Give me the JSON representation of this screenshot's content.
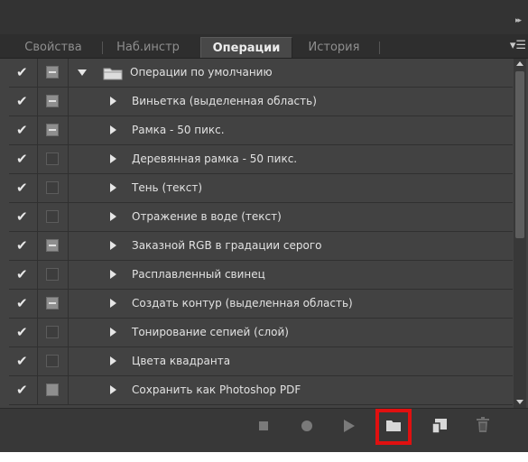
{
  "panel": {
    "tabs": [
      {
        "label": "Свойства",
        "active": false
      },
      {
        "label": "Наб.инстр",
        "active": false
      },
      {
        "label": "Операции",
        "active": true
      },
      {
        "label": "История",
        "active": false
      }
    ]
  },
  "actions": {
    "set": {
      "label": "Операции по умолчанию",
      "checked": true,
      "dialog": "on",
      "expanded": true
    },
    "items": [
      {
        "label": "Виньетка (выделенная область)",
        "checked": true,
        "dialog": "on"
      },
      {
        "label": "Рамка - 50 пикс.",
        "checked": true,
        "dialog": "on"
      },
      {
        "label": "Деревянная рамка - 50 пикс.",
        "checked": true,
        "dialog": "off"
      },
      {
        "label": "Тень (текст)",
        "checked": true,
        "dialog": "off"
      },
      {
        "label": "Отражение в воде (текст)",
        "checked": true,
        "dialog": "off"
      },
      {
        "label": "Заказной RGB в градации серого",
        "checked": true,
        "dialog": "on"
      },
      {
        "label": "Расплавленный свинец",
        "checked": true,
        "dialog": "off"
      },
      {
        "label": "Создать контур (выделенная область)",
        "checked": true,
        "dialog": "on"
      },
      {
        "label": "Тонирование сепией (слой)",
        "checked": true,
        "dialog": "off"
      },
      {
        "label": "Цвета квадранта",
        "checked": true,
        "dialog": "off"
      },
      {
        "label": "Сохранить как Photoshop PDF",
        "checked": true,
        "dialog": "solid"
      }
    ]
  },
  "toolbar": {
    "buttons": [
      "stop-icon",
      "record-icon",
      "play-icon",
      "new-set-icon",
      "new-action-icon",
      "trash-icon"
    ],
    "highlighted": "new-set-icon",
    "highlight_color": "#e01010"
  },
  "colors": {
    "panel_bg": "#424242",
    "text": "#e2e2e2",
    "active_tab_text": "#ececec"
  }
}
